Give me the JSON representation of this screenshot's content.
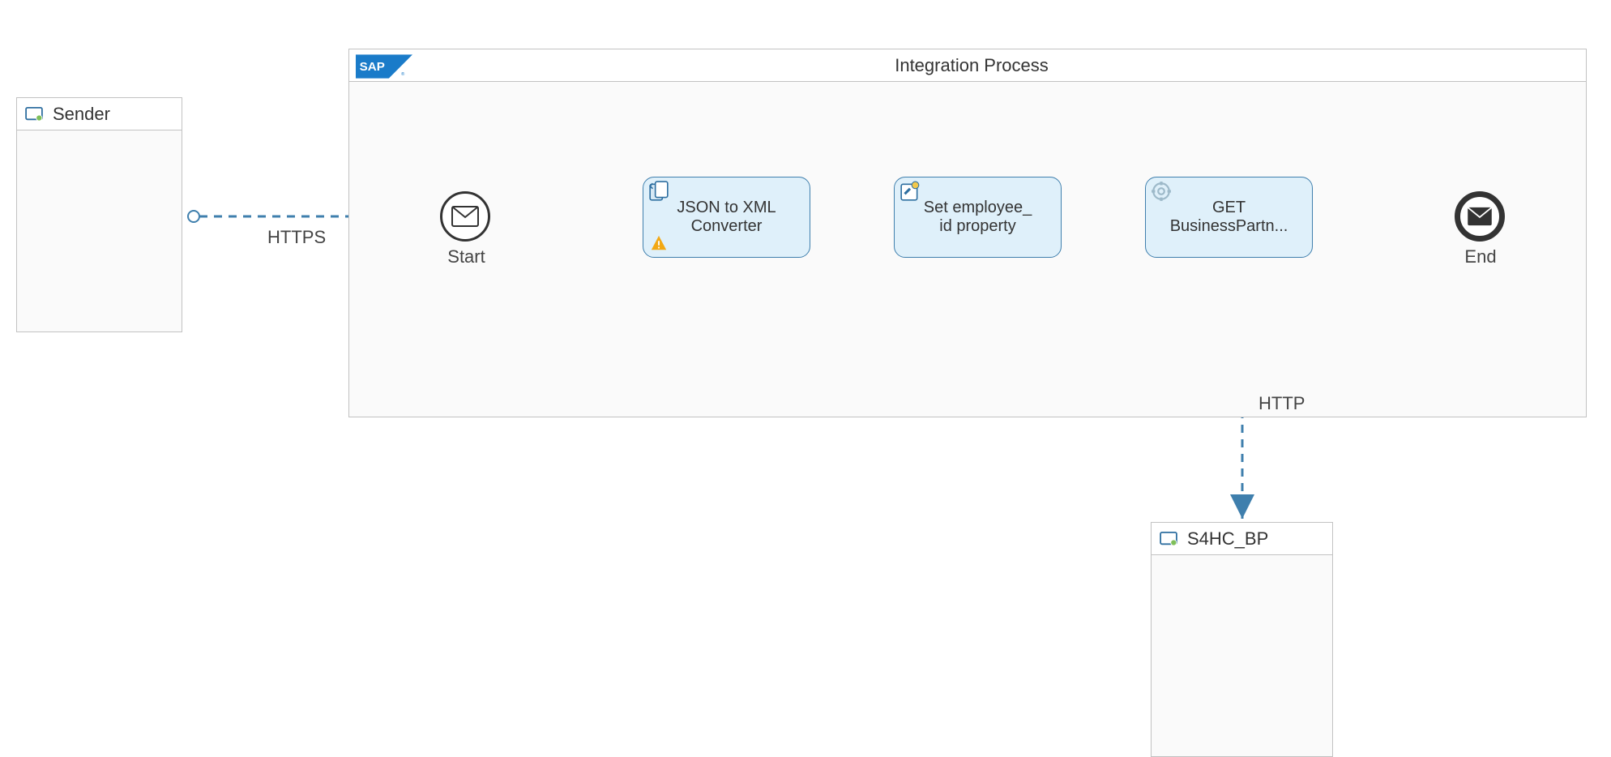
{
  "sender": {
    "label": "Sender"
  },
  "process": {
    "title": "Integration Process",
    "start_label": "Start",
    "end_label": "End",
    "steps": {
      "json_to_xml": {
        "line1": "JSON to XML",
        "line2": "Converter"
      },
      "set_prop": {
        "line1": "Set employee_",
        "line2": "id property"
      },
      "get_bp": {
        "line1": "GET",
        "line2": "BusinessPartn..."
      }
    }
  },
  "receiver": {
    "label": "S4HC_BP"
  },
  "connectors": {
    "sender_to_start": "HTTPS",
    "getbp_to_receiver": "HTTP"
  }
}
